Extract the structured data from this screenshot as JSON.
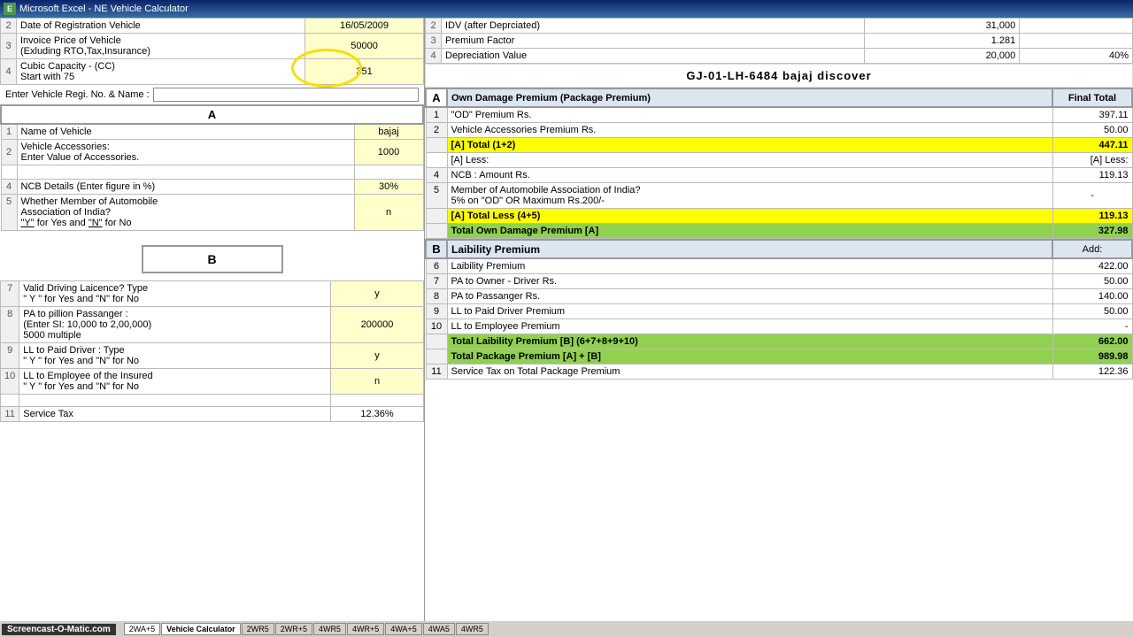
{
  "titleBar": {
    "icon": "E",
    "title": "Microsoft Excel - NE Vehicle Calculator"
  },
  "leftPanel": {
    "topTable": {
      "rows": [
        {
          "rowNum": "2",
          "label": "Date of Registration Vehicle",
          "value": "16/05/2009"
        },
        {
          "rowNum": "3",
          "label": "Invoice Price of Vehicle\n(Exluding RTO,Tax,Insurance)",
          "value": "50000"
        },
        {
          "rowNum": "4",
          "label": "Cubic Capacity - (CC)\nStart with 75",
          "value": "351",
          "highlighted": true
        }
      ]
    },
    "regRow": {
      "label": "Enter Vehicle Regi. No. & Name :",
      "value": ""
    },
    "sectionAHeader": "A",
    "mainTable": {
      "rows": [
        {
          "rowNum": "1",
          "label": "Name of Vehicle",
          "value": "bajaj"
        },
        {
          "rowNum": "2",
          "label": "Vehicle Accessories:\nEnter Value of Accessories.",
          "value": "1000"
        },
        {
          "rowNum": "4",
          "label": "NCB Details (Enter figure in %)",
          "value": "30%"
        },
        {
          "rowNum": "5",
          "label": "Whether Member of Automobile\nAssociation of India?\n\"Y\" for  Yes and \"N\" for No",
          "value": "n"
        }
      ]
    },
    "sectionBHeader": "B",
    "sectionBTable": {
      "rows": [
        {
          "rowNum": "7",
          "label": "Valid Driving Laicence? Type\n\" Y \"  for  Yes and \"N\" for No",
          "value": "y"
        },
        {
          "rowNum": "8",
          "label": "PA to pillion Passanger :\n(Enter SI: 10,000 to 2,00,000)\n5000 multiple",
          "value": "200000"
        },
        {
          "rowNum": "9",
          "label": "LL to Paid Driver :  Type\n\" Y \"  for  Yes and \"N\" for No",
          "value": "y"
        },
        {
          "rowNum": "10",
          "label": "LL to Employee of the Insured\n\" Y \"  for  Yes and \"N\" for No",
          "value": "n"
        }
      ]
    },
    "serviceTaxRow": {
      "rowNum": "11",
      "label": "Service Tax",
      "value": "12.36%"
    }
  },
  "rightPanel": {
    "topTable": {
      "rows": [
        {
          "rowNum": "2",
          "label": "IDV (after Deprciated)",
          "value": "31,000"
        },
        {
          "rowNum": "3",
          "label": "Premium Factor",
          "value": "1.281"
        },
        {
          "rowNum": "4",
          "label": "Depreciation Value",
          "value1": "20,000",
          "value2": "40%"
        }
      ]
    },
    "regDisplay": "GJ-01-LH-6484  bajaj discover",
    "sectionAHeader": "A",
    "colHeader1": "Own Damage Premium (Package Premium)",
    "colHeader2": "Final Total",
    "rows": [
      {
        "rowNum": "1",
        "label": "\"OD\" Premium Rs.",
        "value": "397.11",
        "finalTotal": ""
      },
      {
        "rowNum": "2",
        "label": "Vehicle Accessories Premium Rs.",
        "value": "50.00",
        "finalTotal": ""
      },
      {
        "rowNum": "total",
        "label": "[A]  Total  (1+2)",
        "value": "",
        "finalTotal": "447.11",
        "style": "yellow"
      },
      {
        "rowNum": "",
        "label": "[A] Less:",
        "value": "[A] Less:",
        "finalTotal": "",
        "style": "plain"
      },
      {
        "rowNum": "4",
        "label": "NCB : Amount Rs.",
        "value": "119.13",
        "finalTotal": ""
      },
      {
        "rowNum": "5",
        "label": "Member of Automobile Association of India?\n5% on \"OD\" OR Maximum Rs.200/-",
        "value": "-",
        "finalTotal": ""
      },
      {
        "rowNum": "total2",
        "label": "[A]  Total  Less (4+5)",
        "value": "",
        "finalTotal": "119.13",
        "style": "yellow"
      },
      {
        "rowNum": "total3",
        "label": "Total Own Damage Premium   [A]",
        "value": "",
        "finalTotal": "327.98",
        "style": "green"
      }
    ],
    "sectionBHeader": "B",
    "sectionBLabel": "Laibility Premium",
    "sectionBAdd": "Add:",
    "sectionBRows": [
      {
        "rowNum": "6",
        "label": "Laibility Premium",
        "value": "422.00",
        "finalTotal": ""
      },
      {
        "rowNum": "7",
        "label": "PA to Owner - Driver Rs.",
        "value": "50.00",
        "finalTotal": ""
      },
      {
        "rowNum": "8",
        "label": "PA to Passanger Rs.",
        "value": "140.00",
        "finalTotal": ""
      },
      {
        "rowNum": "9",
        "label": "LL to Paid Driver Premium",
        "value": "50.00",
        "finalTotal": ""
      },
      {
        "rowNum": "10",
        "label": "LL to Employee Premium",
        "value": "-",
        "finalTotal": ""
      }
    ],
    "totalLiability": {
      "label": "Total Laibility Premium   [B] (6+7+8+9+10)",
      "value": "662.00"
    },
    "totalPackage": {
      "label": "Total Package Premium   [A] + [B]",
      "value": "989.98"
    },
    "serviceTaxRow": {
      "rowNum": "11",
      "label": "Service Tax on Total Package Premium",
      "value": "122.36"
    }
  },
  "bottomTabs": {
    "tabs": [
      "2WA+5",
      "Vehicle Calculator",
      "2WR5",
      "2WR+5",
      "4WR5",
      "4WR+5",
      "4WA+5",
      "4WA5",
      "4WR5"
    ]
  },
  "watermark": "Screencast-O-Matic.com"
}
